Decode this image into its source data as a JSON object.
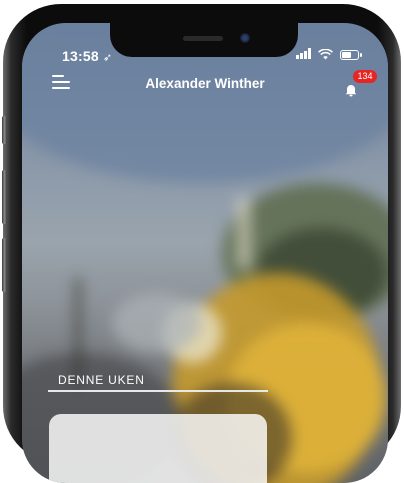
{
  "status_bar": {
    "time": "13:58",
    "location_glyph": "➶",
    "signal_icon": "cellular-signal-icon",
    "wifi_icon": "wifi-icon",
    "battery_icon": "battery-icon"
  },
  "header": {
    "menu_icon": "hamburger-menu-icon",
    "title": "Alexander Winther",
    "notifications": {
      "icon": "bell-icon",
      "count": "134",
      "badge_color": "#e52622"
    }
  },
  "background": {
    "description_icon": "construction-wheel-loader-photo"
  },
  "main": {
    "section_label": "DENNE UKEN"
  }
}
